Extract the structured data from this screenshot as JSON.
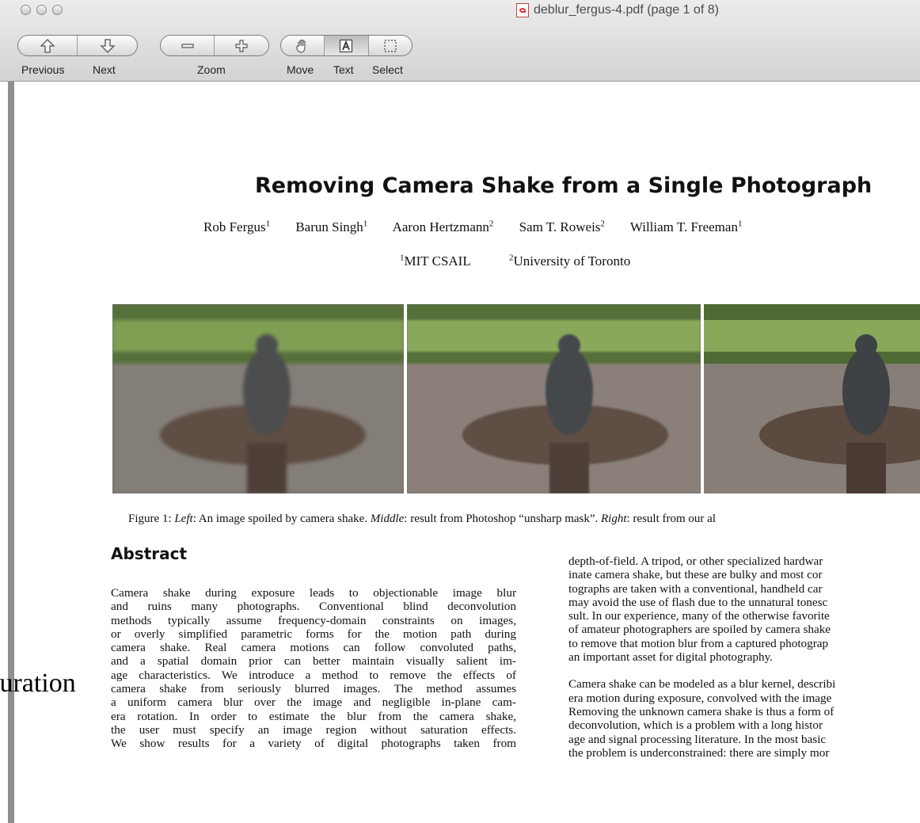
{
  "window": {
    "title": "deblur_fergus-4.pdf (page 1 of 8)"
  },
  "toolbar": {
    "previous_label": "Previous",
    "next_label": "Next",
    "zoom_label": "Zoom",
    "move_label": "Move",
    "text_label": "Text",
    "select_label": "Select"
  },
  "paper": {
    "title": "Removing Camera Shake from a Single Photograph",
    "authors": [
      {
        "name": "Rob Fergus",
        "sup": "1"
      },
      {
        "name": "Barun Singh",
        "sup": "1"
      },
      {
        "name": "Aaron Hertzmann",
        "sup": "2"
      },
      {
        "name": "Sam T. Roweis",
        "sup": "2"
      },
      {
        "name": "William T. Freeman",
        "sup": "1"
      }
    ],
    "affiliations": [
      {
        "sup": "1",
        "name": "MIT CSAIL"
      },
      {
        "sup": "2",
        "name": "University of Toronto"
      }
    ],
    "caption": {
      "prefix": "Figure 1: ",
      "left_em": "Left",
      "left_text": ": An image spoiled by camera shake. ",
      "middle_em": "Middle",
      "middle_text": ": result from Photoshop “unsharp mask”. ",
      "right_em": "Right",
      "right_text": ": result from our al"
    },
    "abstract_heading": "Abstract",
    "abstract_lines": [
      "Camera shake during exposure leads to objectionable image blur",
      "and ruins many photographs. Conventional blind deconvolution",
      "methods typically assume frequency-domain constraints on images,",
      "or overly simplified parametric forms for the motion path during",
      "camera shake. Real camera motions can follow convoluted paths,",
      "and a spatial domain prior can better maintain visually salient im-",
      "age characteristics. We introduce a method to remove the effects of",
      "camera shake from seriously blurred images. The method assumes",
      "a uniform camera blur over the image and negligible in-plane cam-",
      "era rotation. In order to estimate the blur from the camera shake,",
      "the user must specify an image region without saturation effects.",
      "We show results for a variety of digital photographs taken from"
    ],
    "right_para1": [
      "depth-of-field. A tripod, or other specialized hardwar",
      "inate camera shake, but these are bulky and most cor",
      "tographs are taken with a conventional, handheld car",
      "may avoid the use of flash due to the unnatural tonesc",
      "sult. In our experience, many of the otherwise favorite",
      "of amateur photographers are spoiled by camera shake",
      "to remove that motion blur from a captured photograp",
      "an important asset for digital photography."
    ],
    "right_para2": [
      "Camera shake can be modeled as a blur kernel, describi",
      "era motion during exposure, convolved with the image",
      "Removing the unknown camera shake is thus a form of",
      "deconvolution, which is a problem with a long histor",
      "age and signal processing literature. In the most basic",
      "the problem is underconstrained: there are simply mor"
    ]
  },
  "overlay_text": "turation",
  "icons": [
    "up-arrow-icon",
    "down-arrow-icon",
    "minus-icon",
    "plus-icon",
    "hand-icon",
    "text-tool-icon",
    "select-tool-icon",
    "pdf-file-icon"
  ]
}
